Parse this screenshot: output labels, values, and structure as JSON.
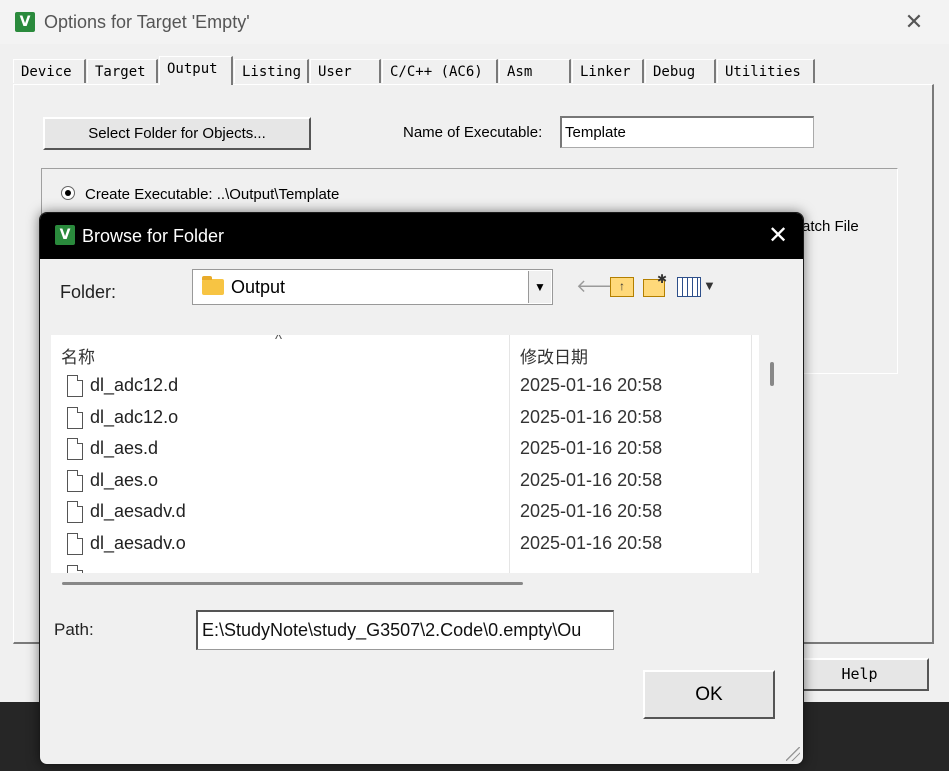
{
  "options_window": {
    "title": "Options for Target 'Empty'",
    "icon": "keil-uvision-icon",
    "tabs": [
      "Device",
      "Target",
      "Output",
      "Listing",
      "User",
      "C/C++ (AC6)",
      "Asm",
      "Linker",
      "Debug",
      "Utilities"
    ],
    "active_tab": "Output",
    "select_folder_label": "Select Folder for Objects...",
    "name_of_executable_label": "Name of Executable:",
    "name_of_executable_value": "Template",
    "create_executable_label": "Create Executable:  ..\\Output\\Template",
    "batch_file_fragment": "atch File",
    "help_label": "Help"
  },
  "browse_dialog": {
    "title": "Browse for Folder",
    "folder_label": "Folder:",
    "folder_value": "Output",
    "columns": {
      "name": "名称",
      "date": "修改日期"
    },
    "files": [
      {
        "name": "dl_adc12.d",
        "date": "2025-01-16 20:58"
      },
      {
        "name": "dl_adc12.o",
        "date": "2025-01-16 20:58"
      },
      {
        "name": "dl_aes.d",
        "date": "2025-01-16 20:58"
      },
      {
        "name": "dl_aes.o",
        "date": "2025-01-16 20:58"
      },
      {
        "name": "dl_aesadv.d",
        "date": "2025-01-16 20:58"
      },
      {
        "name": "dl_aesadv.o",
        "date": "2025-01-16 20:58"
      }
    ],
    "path_label": "Path:",
    "path_value": "E:\\StudyNote\\study_G3507\\2.Code\\0.empty\\Ou",
    "ok_label": "OK"
  },
  "colors": {
    "dialog_titlebar": "#000000",
    "window_bg": "#f0f0f0",
    "app_icon": "#2a8a3c"
  }
}
